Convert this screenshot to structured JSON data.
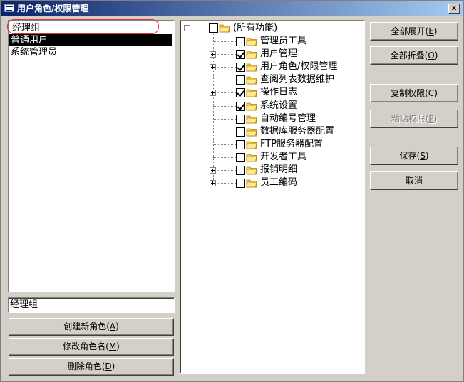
{
  "window": {
    "title": "用户角色/权限管理",
    "close_label": "✕"
  },
  "roles": {
    "name_input_value": "经理组",
    "list": [
      "普通用户",
      "系统管理员"
    ],
    "selected_index": 0,
    "edit_value": "经理组"
  },
  "role_buttons": {
    "create": {
      "text": "创建新角色(",
      "key": "A",
      "end": ")"
    },
    "rename": {
      "text": "修改角色名(",
      "key": "M",
      "end": ")"
    },
    "delete": {
      "text": "删除角色(",
      "key": "D",
      "end": ")"
    }
  },
  "tree": {
    "root": {
      "label": "(所有功能)",
      "checked": false
    },
    "items": [
      {
        "label": "管理员工具",
        "checked": false,
        "expandable": false
      },
      {
        "label": "用户管理",
        "checked": true,
        "expandable": true
      },
      {
        "label": "用户角色/权限管理",
        "checked": true,
        "expandable": true
      },
      {
        "label": "查阅列表数据维护",
        "checked": false,
        "expandable": false
      },
      {
        "label": "操作日志",
        "checked": true,
        "expandable": true
      },
      {
        "label": "系统设置",
        "checked": true,
        "expandable": false
      },
      {
        "label": "自动编号管理",
        "checked": false,
        "expandable": false
      },
      {
        "label": "数据库服务器配置",
        "checked": false,
        "expandable": false
      },
      {
        "label": "FTP服务器配置",
        "checked": false,
        "expandable": false
      },
      {
        "label": "开发者工具",
        "checked": false,
        "expandable": false
      },
      {
        "label": "报销明细",
        "checked": false,
        "expandable": true
      },
      {
        "label": "员工编码",
        "checked": false,
        "expandable": true
      }
    ]
  },
  "side_buttons": {
    "expand_all": {
      "text": "全部展开(",
      "key": "E",
      "end": ")"
    },
    "collapse_all": {
      "text": "全部折叠(",
      "key": "O",
      "end": ")"
    },
    "copy_perm": {
      "text": "复制权限(",
      "key": "C",
      "end": ")"
    },
    "paste_perm": {
      "text": "粘贴权限(",
      "key": "P",
      "end": ")"
    },
    "save": {
      "text": "保存(",
      "key": "S",
      "end": ")"
    },
    "cancel": {
      "text": "取消"
    }
  },
  "colors": {
    "folder": "#ffd24a",
    "highlight_ring": "#e0303a",
    "title_bar": "#0a246a"
  }
}
